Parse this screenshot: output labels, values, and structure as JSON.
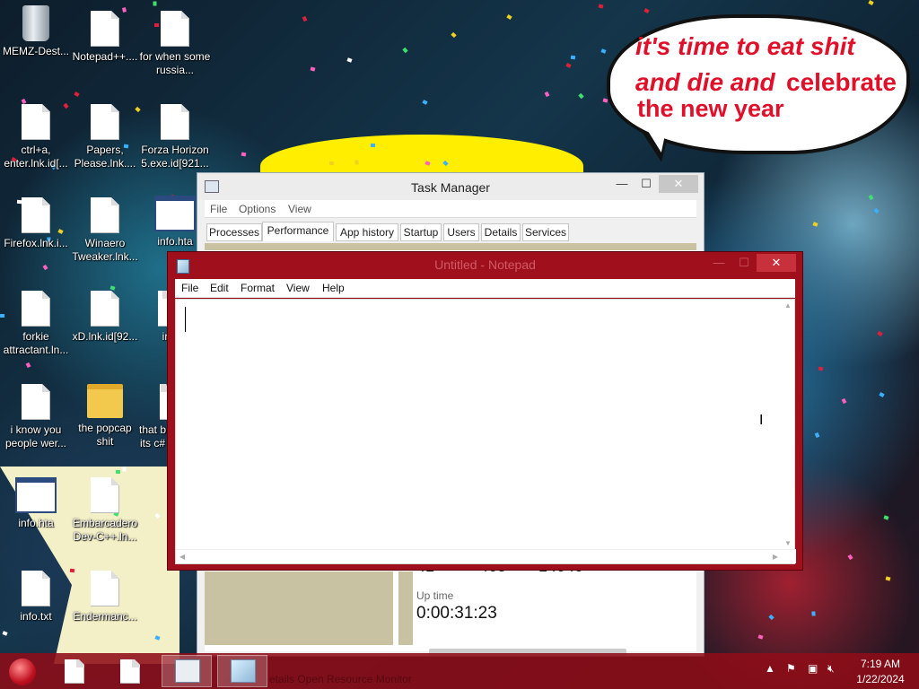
{
  "wallpaper": {
    "bubble_line1": "it's time to eat shit",
    "bubble_line2a": "and die and",
    "bubble_line2b": "celebrate",
    "bubble_line3": "the new year",
    "bubble_text_color": "#e0102a"
  },
  "desktop_icons": [
    {
      "label": "MEMZ-Dest...",
      "icon": "recycle-bin-icon"
    },
    {
      "label": "Notepad++....",
      "icon": "file-icon"
    },
    {
      "label": "for when some russia...",
      "icon": "file-icon"
    },
    {
      "label": "ctrl+a, enter.lnk.id[...",
      "icon": "file-icon"
    },
    {
      "label": "Papers, Please.lnk....",
      "icon": "file-icon"
    },
    {
      "label": "Forza Horizon 5.exe.id[921...",
      "icon": "file-icon"
    },
    {
      "label": "Firefox.lnk.i...",
      "icon": "file-icon"
    },
    {
      "label": "Winaero Tweaker.lnk...",
      "icon": "file-icon"
    },
    {
      "label": "info.hta",
      "icon": "application-window-icon"
    },
    {
      "label": "forkie attractant.ln...",
      "icon": "file-icon"
    },
    {
      "label": "xD.lnk.id[92...",
      "icon": "file-icon"
    },
    {
      "label": "in",
      "icon": "file-icon"
    },
    {
      "label": "i know you people wer...",
      "icon": "file-icon"
    },
    {
      "label": "the popcap shit",
      "icon": "folder-icon"
    },
    {
      "label": "that b its c#",
      "icon": "file-icon"
    },
    {
      "label": "info.hta",
      "icon": "application-window-icon"
    },
    {
      "label": "Embarcadero Dev-C++.ln...",
      "icon": "file-icon"
    },
    {
      "label": "info.txt",
      "icon": "file-icon"
    },
    {
      "label": "Endermanc...",
      "icon": "file-icon"
    }
  ],
  "task_manager": {
    "title": "Task Manager",
    "menu": [
      "File",
      "Options",
      "View"
    ],
    "tabs": [
      "Processes",
      "Performance",
      "App history",
      "Startup",
      "Users",
      "Details",
      "Services"
    ],
    "active_tab": "Performance",
    "stats_partial": [
      "41",
      "468",
      "14040"
    ],
    "uptime_label": "Up time",
    "uptime": "0:00:31:23",
    "controls": {
      "minimize": "—",
      "maximize": "☐",
      "close": "✕"
    }
  },
  "notepad": {
    "title": "Untitled - Notepad",
    "menu": [
      "File",
      "Edit",
      "Format",
      "View",
      "Help"
    ],
    "content": "",
    "controls": {
      "minimize": "—",
      "maximize": "☐",
      "close": "✕"
    },
    "frame_color": "#a0101c"
  },
  "taskbar": {
    "ghost_text": "etails     Open Resource Monitor",
    "clock_time": "7:19 AM",
    "clock_date": "1/22/2024",
    "color": "#8e0c18"
  }
}
